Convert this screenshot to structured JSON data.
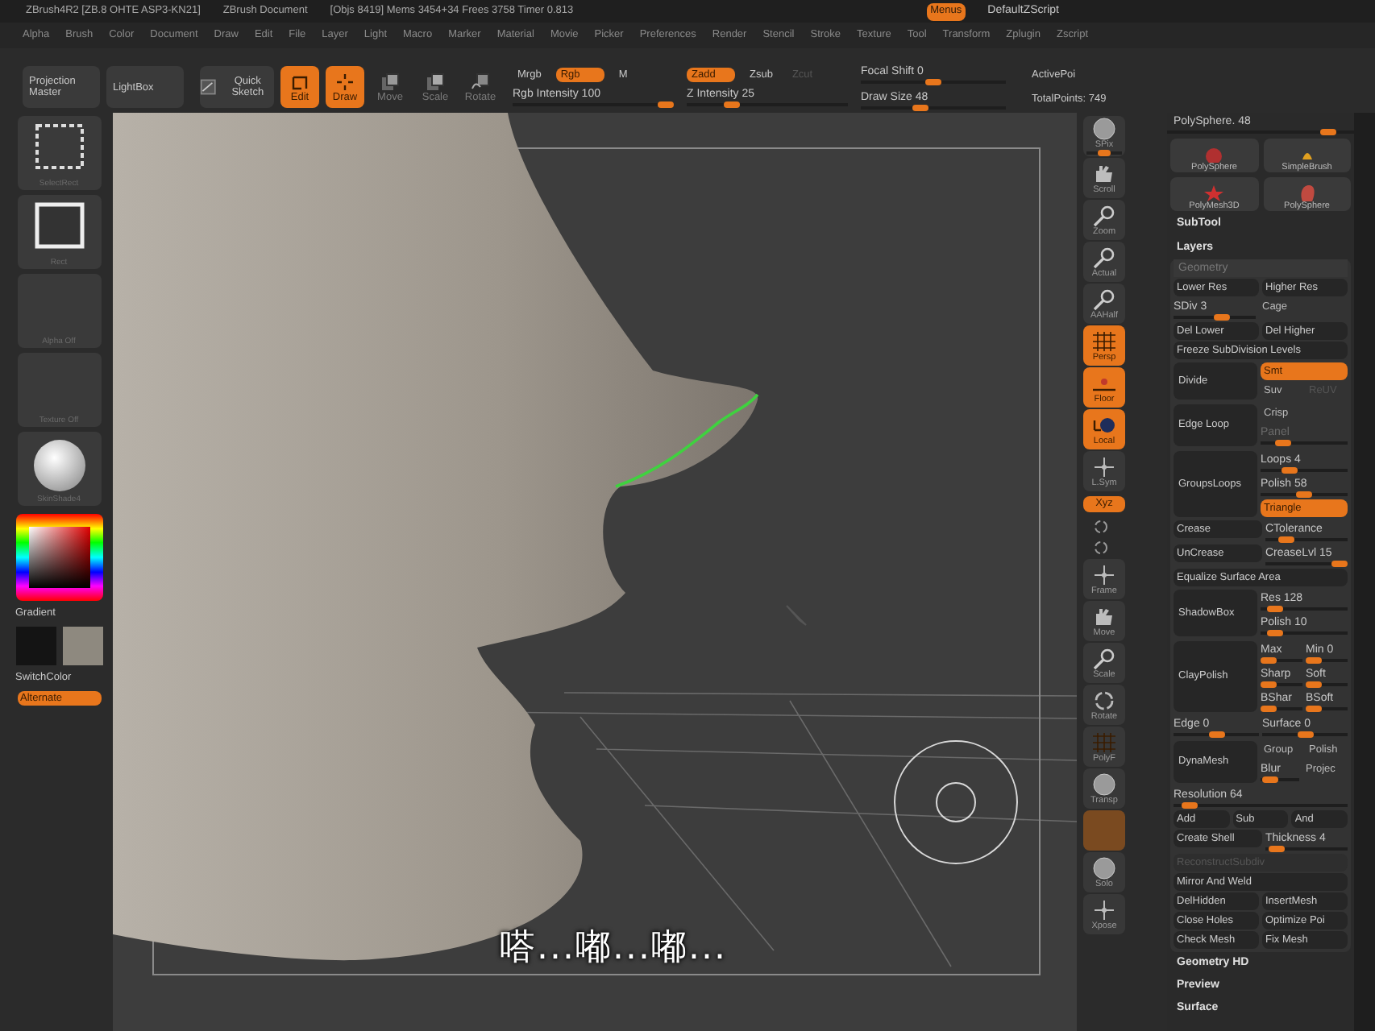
{
  "title_bar": {
    "app": "ZBrush4R2 [ZB.8 OHTE ASP3-KN21]",
    "document": "ZBrush Document",
    "stats": "[Objs 8419] Mems 3454+34 Frees 3758 Timer 0.813",
    "menus_button": {
      "label": "Menus",
      "on": true
    },
    "script": "DefaultZScript"
  },
  "menu_bar": [
    "Alpha",
    "Brush",
    "Color",
    "Document",
    "Draw",
    "Edit",
    "File",
    "Layer",
    "Light",
    "Macro",
    "Marker",
    "Material",
    "Movie",
    "Picker",
    "Preferences",
    "Render",
    "Stencil",
    "Stroke",
    "Texture",
    "Tool",
    "Transform",
    "Zplugin",
    "Zscript"
  ],
  "toolbar": {
    "buttons": [
      {
        "label": "Projection Master",
        "kind": "wide",
        "on": false
      },
      {
        "label": "LightBox",
        "kind": "wide",
        "on": false
      },
      {
        "label": "Quick Sketch",
        "kind": "sketch",
        "on": false
      },
      {
        "label": "Edit",
        "kind": "edit",
        "on": true
      },
      {
        "label": "Draw",
        "kind": "draw",
        "on": true
      },
      {
        "label": "Move",
        "kind": "move",
        "on": false
      },
      {
        "label": "Scale",
        "kind": "scale",
        "on": false
      },
      {
        "label": "Rotate",
        "kind": "rotate",
        "on": false
      }
    ],
    "color_modes": [
      {
        "label": "Mrgb",
        "on": false
      },
      {
        "label": "Rgb",
        "on": true
      },
      {
        "label": "M",
        "on": false
      }
    ],
    "rgb_intensity": {
      "label": "Rgb Intensity 100",
      "level": 1
    },
    "z_modes": [
      {
        "label": "Zadd",
        "on": true,
        "disabled": false
      },
      {
        "label": "Zsub",
        "on": false,
        "disabled": false
      },
      {
        "label": "Zcut",
        "on": false,
        "disabled": true
      }
    ],
    "z_intensity": {
      "label": "Z Intensity 25",
      "level": 0.25
    },
    "focal_shift": {
      "label": "Focal Shift 0",
      "level": 0.5
    },
    "draw_size": {
      "label": "Draw Size 48",
      "level": 0.4
    },
    "active_points": "ActivePoi",
    "total_points": "TotalPoints: 749"
  },
  "left_shelf": {
    "tiles": [
      {
        "label": "SelectRect",
        "kind": "dashed"
      },
      {
        "label": "Rect",
        "kind": "square"
      },
      {
        "label": "Alpha Off",
        "kind": "empty"
      },
      {
        "label": "Texture Off",
        "kind": "empty"
      },
      {
        "label": "SkinShade4",
        "kind": "sphere"
      }
    ],
    "gradient": "Gradient",
    "swatches": [
      {
        "color": "#141414"
      },
      {
        "color": "#8e897f"
      }
    ],
    "switch_color": "SwitchColor",
    "alternate": {
      "label": "Alternate",
      "on": true
    }
  },
  "subtitle": "嗒...嘟...嘟...",
  "right_shelf": [
    {
      "label": "SPix",
      "kind": "sphere",
      "on": false,
      "level": 0.5
    },
    {
      "label": "Scroll",
      "kind": "hand",
      "on": false
    },
    {
      "label": "Zoom",
      "kind": "magnifier",
      "on": false
    },
    {
      "label": "Actual",
      "kind": "magnifier",
      "on": false
    },
    {
      "label": "AAHalf",
      "kind": "magnifier",
      "on": false
    },
    {
      "label": "Persp",
      "kind": "grid",
      "on": true
    },
    {
      "label": "Floor",
      "kind": "floor",
      "on": true
    },
    {
      "label": "Local",
      "kind": "local",
      "on": true
    },
    {
      "label": "L.Sym",
      "kind": "axes",
      "on": false
    },
    {
      "label": "Xyz",
      "kind": "chip",
      "on": true
    },
    {
      "kind": "small-rotate",
      "on": false
    },
    {
      "kind": "small-rotate",
      "on": false
    },
    {
      "label": "Frame",
      "kind": "axes",
      "on": false
    },
    {
      "label": "Move",
      "kind": "hand",
      "on": false
    },
    {
      "label": "Scale",
      "kind": "magnifier",
      "on": false
    },
    {
      "label": "Rotate",
      "kind": "rotate",
      "on": false
    },
    {
      "label": "PolyF",
      "kind": "grid",
      "on": false
    },
    {
      "label": "Transp",
      "kind": "sphere",
      "on": false
    },
    {
      "kind": "blank",
      "on": true
    },
    {
      "label": "Solo",
      "kind": "sphere",
      "on": false
    },
    {
      "label": "Xpose",
      "kind": "axes",
      "on": false
    }
  ],
  "tool_panel": {
    "slider": {
      "label": "PolySphere. 48",
      "level": 0.9
    },
    "thumbs": [
      {
        "label": "PolySphere",
        "kind": "sphere"
      },
      {
        "label": "SimpleBrush",
        "kind": "brush"
      },
      {
        "label": "PolyMesh3D",
        "kind": "star"
      },
      {
        "label": "PolySphere",
        "kind": "head"
      }
    ],
    "sections": [
      "SubTool",
      "Layers"
    ],
    "geometry": {
      "title": "Geometry",
      "rows": [
        {
          "kind": "row",
          "items": [
            {
              "kind": "button",
              "label": "Lower Res"
            },
            {
              "kind": "button",
              "label": "Higher Res"
            }
          ]
        },
        {
          "kind": "row",
          "items": [
            {
              "kind": "slider",
              "label": "SDiv 3",
              "level": 0.6
            },
            {
              "kind": "text",
              "label": "Cage"
            }
          ]
        },
        {
          "kind": "row",
          "items": [
            {
              "kind": "button",
              "label": "Del Lower"
            },
            {
              "kind": "button",
              "label": "Del Higher"
            }
          ]
        },
        {
          "kind": "row",
          "items": [
            {
              "kind": "button",
              "label": "Freeze SubDivision Levels"
            }
          ]
        },
        {
          "kind": "split",
          "big": "Divide",
          "side": [
            [
              {
                "kind": "button",
                "label": "Smt",
                "on": true
              }
            ],
            [
              {
                "kind": "text",
                "label": "Suv"
              },
              {
                "kind": "text",
                "label": "ReUV",
                "disabled": true
              }
            ]
          ]
        },
        {
          "kind": "split",
          "big": "Edge Loop",
          "side": [
            [
              {
                "kind": "text",
                "label": "Crisp"
              }
            ],
            [
              {
                "kind": "slider",
                "label": "Panel",
                "level": 0.2,
                "disabled": true
              }
            ]
          ]
        },
        {
          "kind": "split",
          "big": "GroupsLoops",
          "side": [
            [
              {
                "kind": "slider",
                "label": "Loops 4",
                "level": 0.3
              }
            ],
            [
              {
                "kind": "slider",
                "label": "Polish 58",
                "level": 0.5
              }
            ],
            [
              {
                "kind": "button",
                "label": "Triangle",
                "on": true
              }
            ]
          ]
        },
        {
          "kind": "row",
          "items": [
            {
              "kind": "button",
              "label": "Crease"
            },
            {
              "kind": "slider",
              "label": "CTolerance",
              "level": 0.2
            }
          ]
        },
        {
          "kind": "row",
          "items": [
            {
              "kind": "button",
              "label": "UnCrease"
            },
            {
              "kind": "slider",
              "label": "CreaseLvl 15",
              "level": 1
            }
          ]
        },
        {
          "kind": "row",
          "items": [
            {
              "kind": "button",
              "label": "Equalize Surface Area"
            }
          ]
        },
        {
          "kind": "split",
          "big": "ShadowBox",
          "side": [
            [
              {
                "kind": "slider",
                "label": "Res 128",
                "level": 0.1
              }
            ],
            [
              {
                "kind": "slider",
                "label": "Polish 10",
                "level": 0.1
              }
            ]
          ]
        },
        {
          "kind": "split",
          "big": "ClayPolish",
          "side": [
            [
              {
                "kind": "slider",
                "label": "Max",
                "level": 0
              },
              {
                "kind": "slider",
                "label": "Min 0",
                "level": 0
              }
            ],
            [
              {
                "kind": "slider",
                "label": "Sharp",
                "level": 0
              },
              {
                "kind": "slider",
                "label": "Soft",
                "level": 0
              }
            ],
            [
              {
                "kind": "slider",
                "label": "BShar",
                "level": 0
              },
              {
                "kind": "slider",
                "label": "BSoft",
                "level": 0
              }
            ]
          ]
        },
        {
          "kind": "row",
          "items": [
            {
              "kind": "slider",
              "label": "Edge 0",
              "level": 0.5
            },
            {
              "kind": "slider",
              "label": "Surface 0",
              "level": 0.5
            }
          ]
        },
        {
          "kind": "split",
          "big": "DynaMesh",
          "side": [
            [
              {
                "kind": "text",
                "label": "Group"
              },
              {
                "kind": "text",
                "label": "Polish"
              }
            ],
            [
              {
                "kind": "slider",
                "label": "Blur",
                "level": 0.1
              },
              {
                "kind": "text",
                "label": "Projec"
              }
            ]
          ]
        },
        {
          "kind": "row",
          "items": [
            {
              "kind": "slider",
              "label": "Resolution 64",
              "level": 0.05
            }
          ]
        },
        {
          "kind": "row",
          "items": [
            {
              "kind": "button",
              "label": "Add"
            },
            {
              "kind": "button",
              "label": "Sub"
            },
            {
              "kind": "button",
              "label": "And"
            }
          ]
        },
        {
          "kind": "row",
          "items": [
            {
              "kind": "button",
              "label": "Create Shell"
            },
            {
              "kind": "slider",
              "label": "Thickness 4",
              "level": 0.05
            }
          ]
        },
        {
          "kind": "row",
          "items": [
            {
              "kind": "button",
              "label": "ReconstructSubdiv",
              "disabled": true
            }
          ]
        },
        {
          "kind": "row",
          "items": [
            {
              "kind": "button",
              "label": "Mirror And Weld"
            }
          ]
        },
        {
          "kind": "row",
          "items": [
            {
              "kind": "button",
              "label": "DelHidden"
            },
            {
              "kind": "button",
              "label": "InsertMesh"
            }
          ]
        },
        {
          "kind": "row",
          "items": [
            {
              "kind": "button",
              "label": "Close Holes"
            },
            {
              "kind": "button",
              "label": "Optimize Poi"
            }
          ]
        },
        {
          "kind": "row",
          "items": [
            {
              "kind": "button",
              "label": "Check Mesh"
            },
            {
              "kind": "button",
              "label": "Fix Mesh"
            }
          ]
        }
      ]
    },
    "after": [
      "Geometry HD",
      "Preview",
      "Surface"
    ]
  }
}
